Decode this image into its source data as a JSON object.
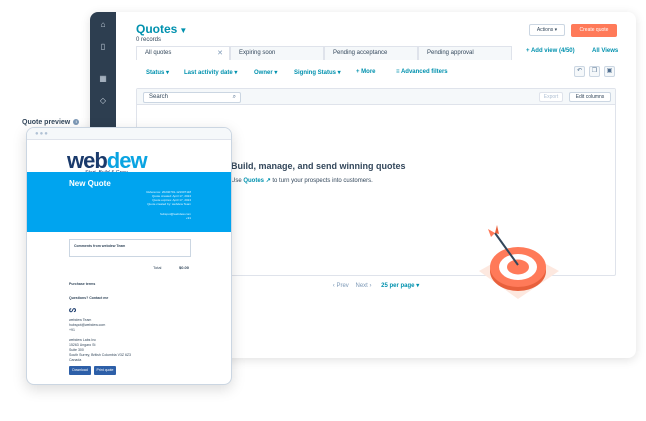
{
  "app": {
    "title": "Quotes",
    "subtitle": "0 records",
    "actions_label": "Actions ▾",
    "create_label": "Create quote"
  },
  "tabs": [
    {
      "label": "All quotes",
      "close": "✕"
    },
    {
      "label": "Expiring soon"
    },
    {
      "label": "Pending acceptance"
    },
    {
      "label": "Pending approval"
    }
  ],
  "views": {
    "add_label": "+ Add view (4/50)",
    "all_label": "All Views"
  },
  "filters": {
    "status": "Status ▾",
    "last_activity": "Last activity date ▾",
    "owner": "Owner ▾",
    "signing_status": "Signing Status ▾",
    "more": "+ More",
    "advanced": "Advanced filters"
  },
  "table": {
    "search_placeholder": "Search",
    "export_label": "Export",
    "edit_columns_label": "Edit columns"
  },
  "empty_state": {
    "heading": "Build, manage, and send winning quotes",
    "body_prefix": "Use",
    "body_link": "Quotes",
    "body_suffix": "to turn your prospects into customers."
  },
  "pagination": {
    "prev": "‹  Prev",
    "next": "Next  ›",
    "per_page": "25 per page ▾"
  },
  "preview": {
    "label": "Quote preview",
    "info": "i",
    "logo_part1": "web",
    "logo_part2": "dew",
    "tagline": "Start, Build & Grow",
    "banner_title": "New Quote",
    "banner_lines": [
      "Reference: 20240701-121607118",
      "Quote created: April 17, 2024",
      "Quote expires: April 17, 2024",
      "Quote created by: webdew Team",
      "",
      "hubspot@webdew.com",
      "+91"
    ],
    "comments": "Comments from webdew Team",
    "total_label": "Total",
    "total_value": "$0.00",
    "purchase_terms": "Purchase terms",
    "questions_title": "Questions? Contact me",
    "contact_lines": [
      "webdew Team",
      "hubspot@webdew.com",
      "+91"
    ],
    "company_lines": [
      "webdew Labs Inc",
      "15263 Ungaro St",
      "Suite 300",
      "South Surrey, British Columbia V3Z 6Z3",
      "Canada"
    ],
    "download_label": "Download",
    "print_label": "Print quote"
  },
  "colors": {
    "brand_teal": "#0091ae",
    "accent_orange": "#ff7a59",
    "nav_dark": "#2d3e50",
    "banner_blue": "#00a4ef"
  }
}
